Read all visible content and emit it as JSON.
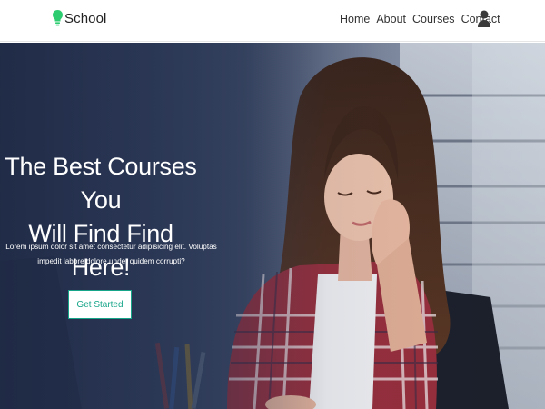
{
  "brand": {
    "name": "School",
    "accent_color": "#2ecc71",
    "icon": "lightbulb-icon"
  },
  "nav": {
    "links": [
      {
        "label": "Home"
      },
      {
        "label": "About"
      },
      {
        "label": "Courses"
      },
      {
        "label": "Contact"
      }
    ],
    "user_icon": "user-icon"
  },
  "hero": {
    "title_line1": "The Best Courses You",
    "title_line2": "Will Find Find Here!",
    "text_line1": "Lorem ipsum dolor sit amet consectetur adipisicing elit. Voluptas",
    "text_line2": "impedit labore dolore unde, quidem corrupti?",
    "cta_label": "Get Started",
    "cta_color": "#17a589",
    "overlay_color": "#2d3a55"
  }
}
